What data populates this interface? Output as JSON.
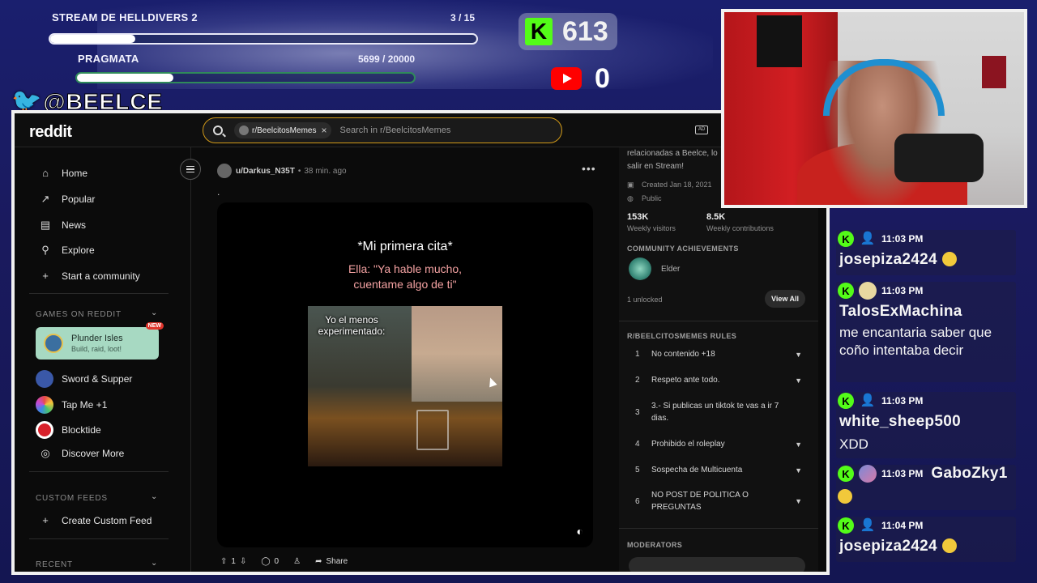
{
  "goals": [
    {
      "title": "STREAM DE HELLDIVERS 2",
      "count": "3 / 15",
      "progress": 0.2
    },
    {
      "title": "PRAGMATA",
      "count": "5699 / 20000",
      "progress": 0.285
    }
  ],
  "kick": {
    "logo": "K",
    "count": "613",
    "color": "#53fc18"
  },
  "youtube": {
    "count": "0",
    "color": "#ff0000"
  },
  "twitter": {
    "icon": "twitter-bird-icon",
    "handle": "@BEELCE_"
  },
  "reddit": {
    "logo": "reddit",
    "search": {
      "chip": "r/BeelcitosMemes",
      "chip_close": "×",
      "placeholder": "Search in r/BeelcitosMemes"
    },
    "sidebar": {
      "nav": [
        {
          "icon": "home-icon",
          "glyph": "⌂",
          "label": "Home"
        },
        {
          "icon": "popular-icon",
          "glyph": "↗",
          "label": "Popular"
        },
        {
          "icon": "news-icon",
          "glyph": "▤",
          "label": "News"
        },
        {
          "icon": "explore-icon",
          "glyph": "⚲",
          "label": "Explore"
        },
        {
          "icon": "plus-icon",
          "glyph": "+",
          "label": "Start a community"
        }
      ],
      "games_label": "GAMES ON REDDIT",
      "featured_game": {
        "name": "Plunder Isles",
        "subtitle": "Build, raid, loot!",
        "badge": "NEW"
      },
      "games": [
        {
          "label": "Sword & Supper",
          "color": "#3a58a8"
        },
        {
          "label": "Tap Me +1",
          "color": "#d64a8a"
        },
        {
          "label": "Blocktide",
          "color": "#d8202a"
        },
        {
          "label": "Discover More",
          "glyph": "◎"
        }
      ],
      "custom_feeds_label": "CUSTOM FEEDS",
      "create_feed": {
        "glyph": "+",
        "label": "Create Custom Feed"
      },
      "recent_label": "RECENT"
    },
    "post": {
      "author": "u/Darkus_N35T",
      "separator": "•",
      "time": "38 min. ago",
      "more": "•••",
      "body": ".",
      "meme_title": "*Mi primera cita*",
      "meme_line1": "Ella: \"Ya hable mucho,",
      "meme_line2": "cuentame algo de ti\"",
      "meme_caption": "Yo el menos experimentado:",
      "votes": "1",
      "comments": "0",
      "share": "Share"
    },
    "right": {
      "desc_line1": "relacionadas a Beelce, lo",
      "desc_line2": "salir en Stream!",
      "created": "Created Jan 18, 2021",
      "visibility": "Public",
      "visitors": "153K",
      "visitors_label": "Weekly visitors",
      "contributions": "8.5K",
      "contributions_label": "Weekly contributions",
      "achievements_label": "COMMUNITY ACHIEVEMENTS",
      "achievement": "Elder",
      "unlocked": "1 unlocked",
      "view_all": "View All",
      "rules_label": "R/BEELCITOSMEMES RULES",
      "rules": [
        {
          "num": "1",
          "text": "No contenido +18"
        },
        {
          "num": "2",
          "text": "Respeto ante todo."
        },
        {
          "num": "3",
          "text": "3.- Si publicas un tiktok te vas a ir 7 dias."
        },
        {
          "num": "4",
          "text": "Prohibido el roleplay"
        },
        {
          "num": "5",
          "text": "Sospecha de Multicuenta"
        },
        {
          "num": "6",
          "text": "NO POST DE POLITICA O PREGUNTAS"
        }
      ],
      "moderators_label": "MODERATORS"
    }
  },
  "chat": [
    {
      "time": "11:03 PM",
      "name": "josepiza2424",
      "text": "",
      "avatar": "user"
    },
    {
      "time": "11:03 PM",
      "name": "TalosExMachina",
      "text": "me encantaria saber que coño intentaba decir",
      "avatar": "custom"
    },
    {
      "time": "11:03 PM",
      "name": "white_sheep500",
      "text": "XDD",
      "avatar": "user"
    },
    {
      "time": "11:03 PM",
      "name": "GaboZky1",
      "text": "",
      "avatar": "custom"
    },
    {
      "time": "11:04 PM",
      "name": "josepiza2424",
      "text": "",
      "avatar": "user"
    }
  ]
}
